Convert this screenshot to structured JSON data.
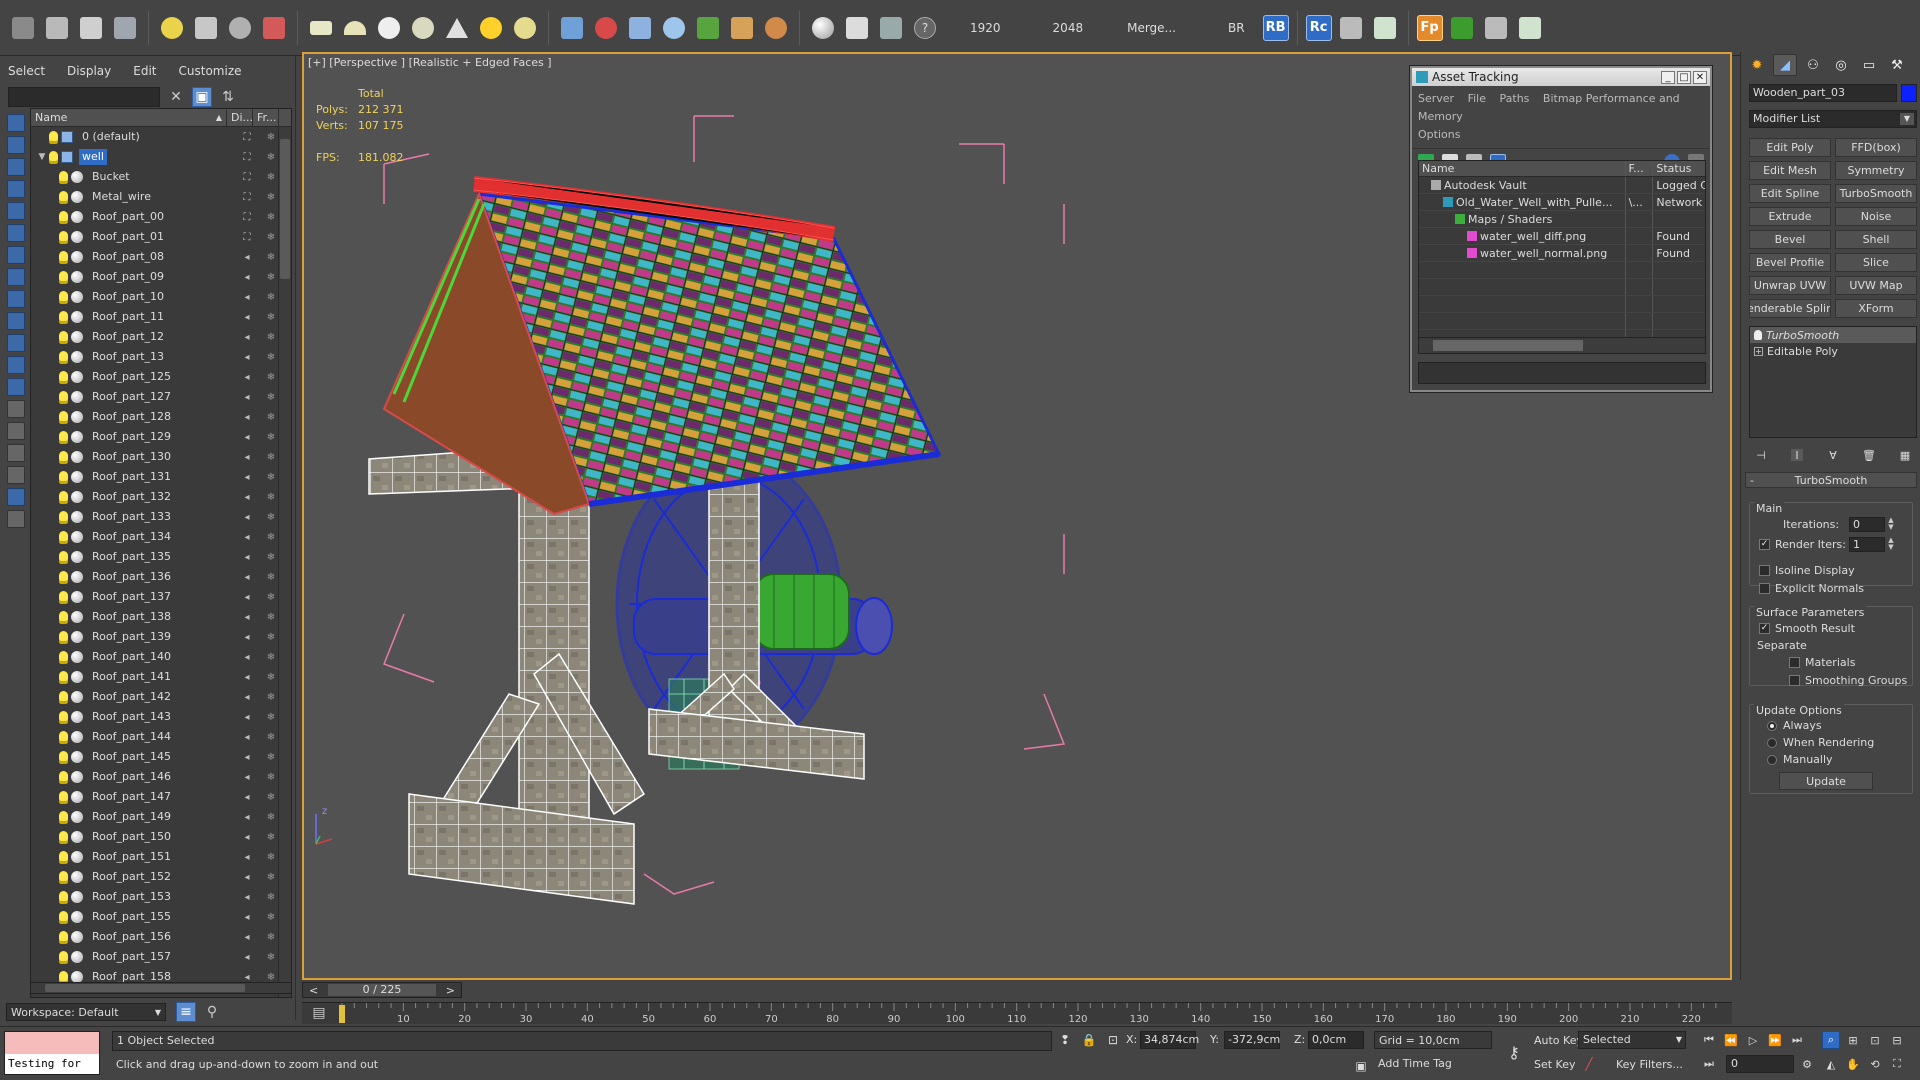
{
  "toolbar": {
    "render_width": "1920",
    "render_height": "2048",
    "merge_label": "Merge...",
    "br_label": "BR",
    "rb_label": "RB",
    "rc_label": "Rc",
    "fp_label": "Fp"
  },
  "explorer": {
    "menu": [
      "Select",
      "Display",
      "Edit",
      "Customize"
    ],
    "search_value": "",
    "columns": {
      "name": "Name",
      "display": "Di...",
      "freeze": "Fr..."
    },
    "rows": [
      {
        "name": "0 (default)",
        "level": 0,
        "type": "layer",
        "selected": false
      },
      {
        "name": "well",
        "level": 0,
        "type": "layer",
        "selected": true,
        "expanded": true
      },
      {
        "name": "Bucket",
        "level": 1,
        "type": "object"
      },
      {
        "name": "Metal_wire",
        "level": 1,
        "type": "object"
      },
      {
        "name": "Roof_part_00",
        "level": 1,
        "type": "object"
      },
      {
        "name": "Roof_part_01",
        "level": 1,
        "type": "object"
      },
      {
        "name": "Roof_part_08",
        "level": 1,
        "type": "object"
      },
      {
        "name": "Roof_part_09",
        "level": 1,
        "type": "object"
      },
      {
        "name": "Roof_part_10",
        "level": 1,
        "type": "object"
      },
      {
        "name": "Roof_part_11",
        "level": 1,
        "type": "object"
      },
      {
        "name": "Roof_part_12",
        "level": 1,
        "type": "object"
      },
      {
        "name": "Roof_part_13",
        "level": 1,
        "type": "object"
      },
      {
        "name": "Roof_part_125",
        "level": 1,
        "type": "object"
      },
      {
        "name": "Roof_part_127",
        "level": 1,
        "type": "object"
      },
      {
        "name": "Roof_part_128",
        "level": 1,
        "type": "object"
      },
      {
        "name": "Roof_part_129",
        "level": 1,
        "type": "object"
      },
      {
        "name": "Roof_part_130",
        "level": 1,
        "type": "object"
      },
      {
        "name": "Roof_part_131",
        "level": 1,
        "type": "object"
      },
      {
        "name": "Roof_part_132",
        "level": 1,
        "type": "object"
      },
      {
        "name": "Roof_part_133",
        "level": 1,
        "type": "object"
      },
      {
        "name": "Roof_part_134",
        "level": 1,
        "type": "object"
      },
      {
        "name": "Roof_part_135",
        "level": 1,
        "type": "object"
      },
      {
        "name": "Roof_part_136",
        "level": 1,
        "type": "object"
      },
      {
        "name": "Roof_part_137",
        "level": 1,
        "type": "object"
      },
      {
        "name": "Roof_part_138",
        "level": 1,
        "type": "object"
      },
      {
        "name": "Roof_part_139",
        "level": 1,
        "type": "object"
      },
      {
        "name": "Roof_part_140",
        "level": 1,
        "type": "object"
      },
      {
        "name": "Roof_part_141",
        "level": 1,
        "type": "object"
      },
      {
        "name": "Roof_part_142",
        "level": 1,
        "type": "object"
      },
      {
        "name": "Roof_part_143",
        "level": 1,
        "type": "object"
      },
      {
        "name": "Roof_part_144",
        "level": 1,
        "type": "object"
      },
      {
        "name": "Roof_part_145",
        "level": 1,
        "type": "object"
      },
      {
        "name": "Roof_part_146",
        "level": 1,
        "type": "object"
      },
      {
        "name": "Roof_part_147",
        "level": 1,
        "type": "object"
      },
      {
        "name": "Roof_part_149",
        "level": 1,
        "type": "object"
      },
      {
        "name": "Roof_part_150",
        "level": 1,
        "type": "object"
      },
      {
        "name": "Roof_part_151",
        "level": 1,
        "type": "object"
      },
      {
        "name": "Roof_part_152",
        "level": 1,
        "type": "object"
      },
      {
        "name": "Roof_part_153",
        "level": 1,
        "type": "object"
      },
      {
        "name": "Roof_part_155",
        "level": 1,
        "type": "object"
      },
      {
        "name": "Roof_part_156",
        "level": 1,
        "type": "object"
      },
      {
        "name": "Roof_part_157",
        "level": 1,
        "type": "object"
      },
      {
        "name": "Roof_part_158",
        "level": 1,
        "type": "object"
      }
    ],
    "workspace": "Workspace: Default"
  },
  "viewport": {
    "label": "[+] [Perspective ] [Realistic + Edged Faces ]",
    "stats": {
      "total_label": "Total",
      "polys_label": "Polys:",
      "polys_value": "212 371",
      "verts_label": "Verts:",
      "verts_value": "107 175",
      "fps_label": "FPS:",
      "fps_value": "181.082"
    },
    "axis_z": "z"
  },
  "asset_tracking": {
    "title": "Asset Tracking",
    "menu_line1": [
      "Server",
      "File",
      "Paths",
      "Bitmap Performance and Memory"
    ],
    "menu_line2": [
      "Options"
    ],
    "columns": {
      "name": "Name",
      "full_path": "F...",
      "status": "Status"
    },
    "rows": [
      {
        "name": "Autodesk Vault",
        "indent": 1,
        "path": "",
        "status": "Logged C"
      },
      {
        "name": "Old_Water_Well_with_Pulle...",
        "indent": 2,
        "path": "\\...",
        "status": "Network"
      },
      {
        "name": "Maps / Shaders",
        "indent": 3,
        "path": "",
        "status": ""
      },
      {
        "name": "water_well_diff.png",
        "indent": 4,
        "path": "",
        "status": "Found"
      },
      {
        "name": "water_well_normal.png",
        "indent": 4,
        "path": "",
        "status": "Found"
      }
    ]
  },
  "command_panel": {
    "object_name": "Wooden_part_03",
    "object_color": "#0b22ff",
    "modifier_list": "Modifier List",
    "modifier_buttons": [
      "Edit Poly",
      "FFD(box)",
      "Edit Mesh",
      "Symmetry",
      "Edit Spline",
      "TurboSmooth",
      "Extrude",
      "Noise",
      "Bevel",
      "Shell",
      "Bevel Profile",
      "Slice",
      "Unwrap UVW",
      "UVW Map",
      "enderable Splin",
      "XForm"
    ],
    "stack": [
      {
        "name": "TurboSmooth",
        "active": true
      },
      {
        "name": "Editable Poly",
        "active": false
      }
    ],
    "turbosmooth": {
      "header": "TurboSmooth",
      "main_label": "Main",
      "iterations_label": "Iterations:",
      "iterations_value": "0",
      "render_iters_label": "Render Iters:",
      "render_iters_value": "1",
      "isoline_label": "Isoline Display",
      "explicit_normals_label": "Explicit Normals",
      "surface_label": "Surface Parameters",
      "smooth_result_label": "Smooth Result",
      "separate_label": "Separate",
      "materials_label": "Materials",
      "smoothing_groups_label": "Smoothing Groups",
      "update_options_label": "Update Options",
      "always_label": "Always",
      "when_rendering_label": "When Rendering",
      "manually_label": "Manually",
      "update_button": "Update"
    }
  },
  "timeline": {
    "frame_label": "0 / 225",
    "ticks": [
      10,
      20,
      30,
      40,
      50,
      60,
      70,
      80,
      90,
      100,
      110,
      120,
      130,
      140,
      150,
      160,
      170,
      180,
      190,
      200,
      210,
      220
    ],
    "max_frame": 225
  },
  "status": {
    "listener_text": "Testing for",
    "selection": "1 Object Selected",
    "prompt": "Click and drag up-and-down to zoom in and out",
    "x_label": "X:",
    "x_value": "34,874cm",
    "y_label": "Y:",
    "y_value": "-372,9cm",
    "z_label": "Z:",
    "z_value": "0,0cm",
    "grid": "Grid = 10,0cm",
    "add_time_tag": "Add Time Tag",
    "auto_key": "Auto Key",
    "set_key": "Set Key",
    "selected": "Selected",
    "key_filters": "Key Filters...",
    "frame": "0"
  }
}
